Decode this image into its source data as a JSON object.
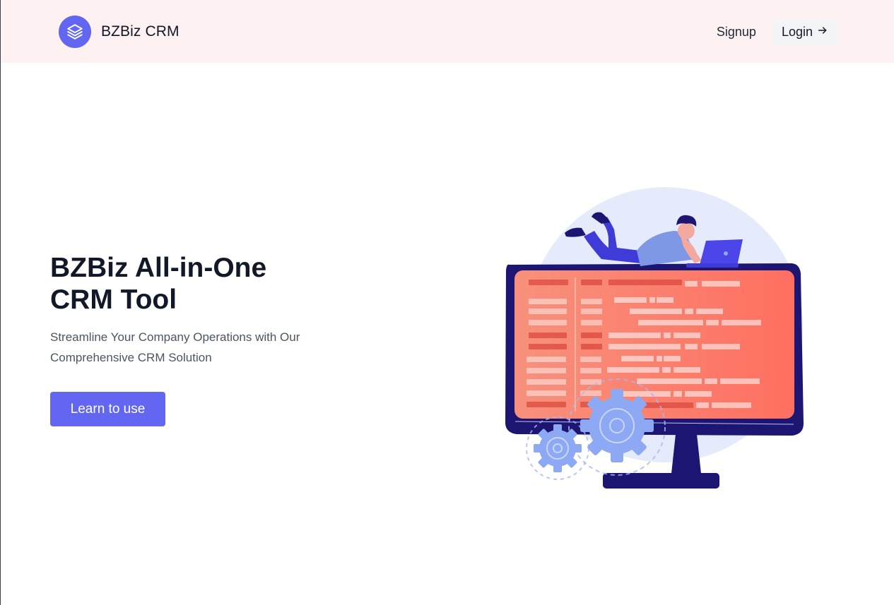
{
  "header": {
    "brand_name": "BZBiz CRM",
    "logo_icon": "layers-icon",
    "nav": {
      "signup_label": "Signup",
      "login_label": "Login",
      "login_icon": "arrow-right-icon"
    }
  },
  "hero": {
    "title_line1": "BZBiz All-in-One",
    "title_line2": "CRM Tool",
    "subtitle_line1": "Streamline Your Company Operations with Our",
    "subtitle_line2": "Comprehensive CRM Solution",
    "cta_label": "Learn to use"
  },
  "colors": {
    "accent": "#6366f1",
    "header_bg": "#fdf1f1",
    "monitor_frame": "#1e1b7a",
    "screen": "#ff7b6b"
  }
}
